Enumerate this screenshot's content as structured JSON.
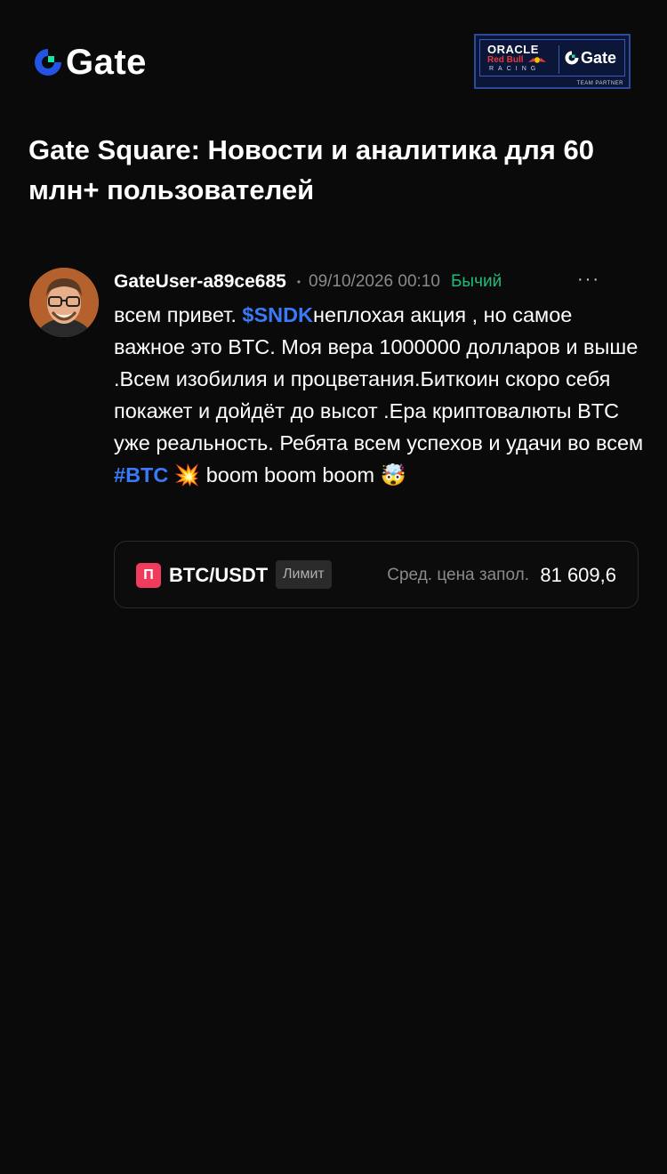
{
  "header": {
    "logo_text": "Gate",
    "partner_badge": {
      "oracle": "ORACLE",
      "redbull": "Red Bull",
      "racing": "RACING",
      "gate": "Gate",
      "team_partner": "TEAM PARTNER"
    }
  },
  "page_title": "Gate Square: Новости и аналитика для 60 млн+ пользователей",
  "post": {
    "username": "GateUser-a89ce685",
    "separator": "•",
    "timestamp": "09/10/2026 00:10",
    "sentiment": "Бычий",
    "more_label": "···",
    "body": {
      "part1": "всем привет. ",
      "ticker_link": "$SNDK",
      "part2": "неплохая акция , но самое важное это BTC. Моя вера 1000000 долларов и выше .Всем изобилия и процветания.Биткоин скоро себя покажет и дойдёт до высот .Ера криптовалюты BTC уже реальность. Ребята всем успехов и удачи во всем ",
      "hashtag_link": "#BTC",
      "part3": " ",
      "emoji_boom": "💥",
      "part4": " boom boom boom ",
      "emoji_mindblown": "🤯"
    },
    "trade": {
      "side_badge": "П",
      "pair": "BTC/USDT",
      "order_type": "Лимит",
      "avg_price_label": "Сред. цена запол.",
      "avg_price_value": "81 609,6"
    }
  },
  "colors": {
    "background": "#0a0a0a",
    "link_blue": "#3a7af8",
    "bullish_green": "#1fbb7a",
    "sell_badge_red": "#ef3b5d",
    "muted_text": "#8a8a8a"
  },
  "icons": {
    "logo": "gate-logo-icon",
    "avatar": "user-avatar",
    "more": "more-dots-icon"
  }
}
